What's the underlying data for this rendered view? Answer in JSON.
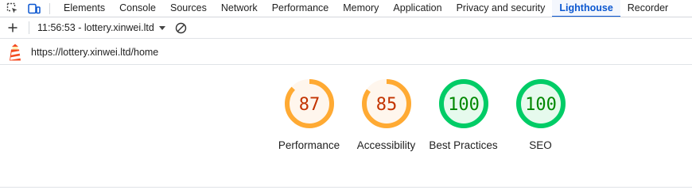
{
  "tabbar": {
    "tabs": [
      {
        "label": "Elements",
        "active": false
      },
      {
        "label": "Console",
        "active": false
      },
      {
        "label": "Sources",
        "active": false
      },
      {
        "label": "Network",
        "active": false
      },
      {
        "label": "Performance",
        "active": false
      },
      {
        "label": "Memory",
        "active": false
      },
      {
        "label": "Application",
        "active": false
      },
      {
        "label": "Privacy and security",
        "active": false
      },
      {
        "label": "Lighthouse",
        "active": true
      },
      {
        "label": "Recorder",
        "active": false
      }
    ]
  },
  "toolbar": {
    "report_select": "11:56:53 - lottery.xinwei.ltd"
  },
  "report": {
    "url": "https://lottery.xinwei.ltd/home",
    "gauges": [
      {
        "name": "performance",
        "label": "Performance",
        "score": "87",
        "fraction": 0.87,
        "color": "#c33300",
        "ring": "#fa3",
        "fill": "#fff6ed"
      },
      {
        "name": "accessibility",
        "label": "Accessibility",
        "score": "85",
        "fraction": 0.85,
        "color": "#c33300",
        "ring": "#fa3",
        "fill": "#fff6ed"
      },
      {
        "name": "best-practices",
        "label": "Best Practices",
        "score": "100",
        "fraction": 1.0,
        "color": "#008800",
        "ring": "#0c6",
        "fill": "#e6faed"
      },
      {
        "name": "seo",
        "label": "SEO",
        "score": "100",
        "fraction": 1.0,
        "color": "#008800",
        "ring": "#0c6",
        "fill": "#e6faed"
      }
    ]
  },
  "colors": {
    "accent": "#0b57d0",
    "average": "#fa3",
    "pass": "#0c6"
  }
}
